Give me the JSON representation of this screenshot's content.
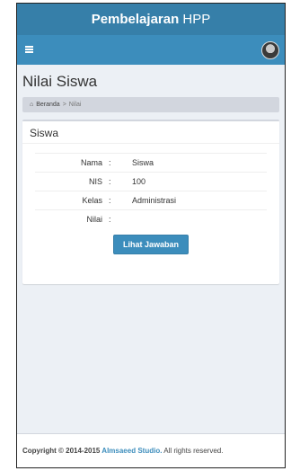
{
  "header": {
    "logo_bold": "Pembelajaran",
    "logo_light": " HPP"
  },
  "navbar": {
    "menu_icon": "hamburger-icon",
    "avatar_icon": "user-avatar"
  },
  "page": {
    "title": "Nilai Siswa",
    "breadcrumb": {
      "home_icon": "home-icon",
      "home": "Beranda",
      "separator": ">",
      "current": "Nilai"
    }
  },
  "box": {
    "title": "Siswa",
    "rows": [
      {
        "label": "Nama",
        "colon": ":",
        "value": "Siswa"
      },
      {
        "label": "NIS",
        "colon": ":",
        "value": "100"
      },
      {
        "label": "Kelas",
        "colon": ":",
        "value": "Administrasi"
      },
      {
        "label": "Nilai",
        "colon": ":",
        "value": ""
      }
    ],
    "button_label": "Lihat Jawaban"
  },
  "footer": {
    "copyright": "Copyright © 2014-2015 ",
    "studio": "Almsaeed Studio.",
    "rights": " All rights reserved."
  },
  "colors": {
    "logo_bg": "#367fa9",
    "navbar_bg": "#3c8dbc",
    "content_bg": "#ecf0f5",
    "button_bg": "#3c8dbc"
  }
}
